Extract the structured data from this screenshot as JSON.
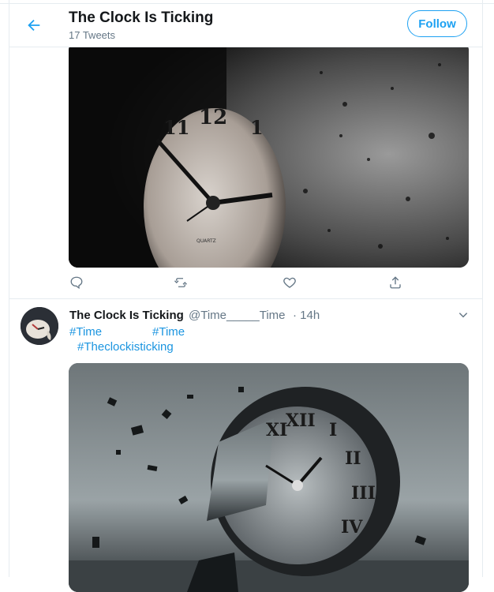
{
  "header": {
    "title": "The Clock Is Ticking",
    "tweet_count": "17 Tweets",
    "follow_label": "Follow"
  },
  "tweet1": {
    "actions": [
      "reply-icon",
      "retweet-icon",
      "like-icon",
      "share-icon"
    ]
  },
  "tweet2": {
    "display_name": "The Clock Is Ticking",
    "handle": "@Time_____Time",
    "time": "· 14h",
    "hashtags": [
      "#Time",
      "#Time",
      "#Theclockisticking"
    ]
  },
  "colors": {
    "accent": "#1da1f2",
    "hashtag": "#1b95e0",
    "secondary_text": "#657786",
    "divider": "#e6ecf0"
  }
}
